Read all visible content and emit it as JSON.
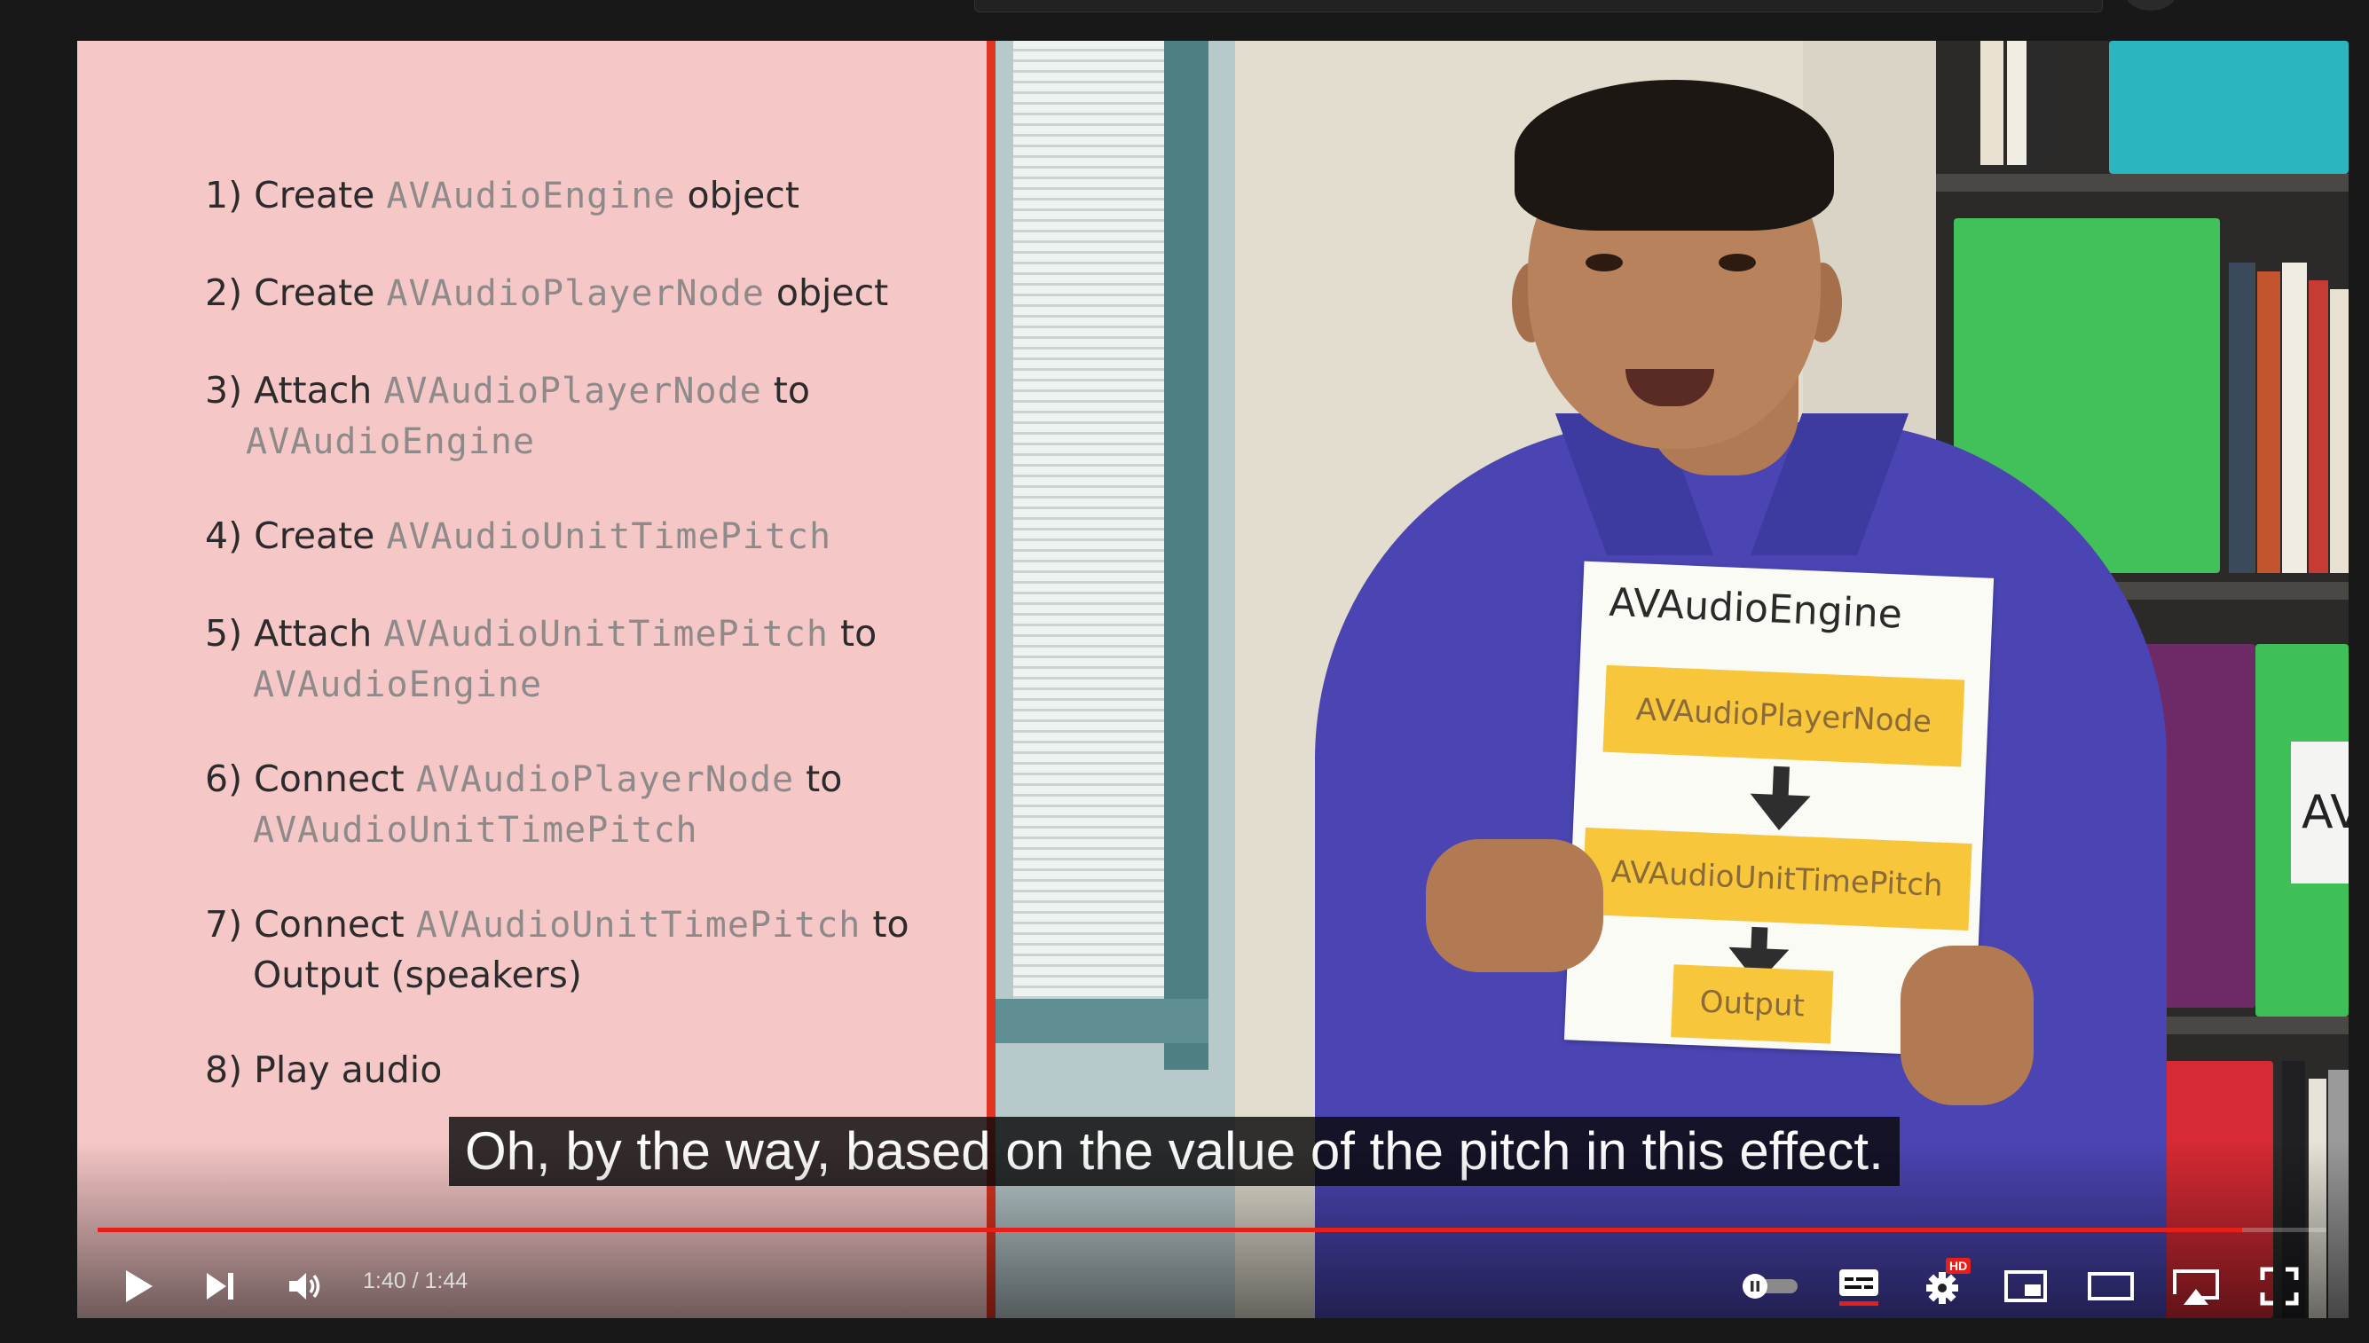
{
  "slide": {
    "steps": [
      {
        "num": "1)",
        "before": "Create",
        "code": "AVAudioEngine",
        "after": "object",
        "code2": "",
        "after2": ""
      },
      {
        "num": "2)",
        "before": "Create",
        "code": "AVAudioPlayerNode",
        "after": "object",
        "code2": "",
        "after2": ""
      },
      {
        "num": "3)",
        "before": "Attach",
        "code": "AVAudioPlayerNode",
        "after": "to",
        "code2": "AVAudioEngine",
        "after2": ""
      },
      {
        "num": "4)",
        "before": "Create",
        "code": "AVAudioUnitTimePitch",
        "after": "",
        "code2": "",
        "after2": ""
      },
      {
        "num": "5)",
        "before": "Attach",
        "code": "AVAudioUnitTimePitch",
        "after": "to",
        "code2": "AVAudioEngine",
        "after2": ""
      },
      {
        "num": "6)",
        "before": "Connect",
        "code": "AVAudioPlayerNode",
        "after": "to",
        "code2": "AVAudioUnitTimePitch",
        "after2": ""
      },
      {
        "num": "7)",
        "before": "Connect",
        "code": "AVAudioUnitTimePitch",
        "after": "to",
        "code2": "",
        "after2": "Output (speakers)"
      },
      {
        "num": "8)",
        "before": "Play audio",
        "code": "",
        "after": "",
        "code2": "",
        "after2": ""
      }
    ]
  },
  "scene": {
    "paper_title": "AVAudioEngine",
    "paper_boxes": [
      "AVAudioPlayerNode",
      "AVAudioUnitTimePitch",
      "Output"
    ],
    "shelf_label": "AVFo"
  },
  "caption": "Oh, by the way, based on the value of the pitch in this effect.",
  "player": {
    "current_time": "1:40",
    "separator": " / ",
    "duration": "1:44",
    "progress_fraction": 0.962,
    "hd_badge": "HD",
    "accent_color": "#e5201b"
  },
  "icons": [
    "play-icon",
    "next-icon",
    "volume-icon",
    "autoplay-toggle-icon",
    "subtitles-icon",
    "settings-icon",
    "miniplayer-icon",
    "theater-mode-icon",
    "cast-icon",
    "fullscreen-icon"
  ]
}
